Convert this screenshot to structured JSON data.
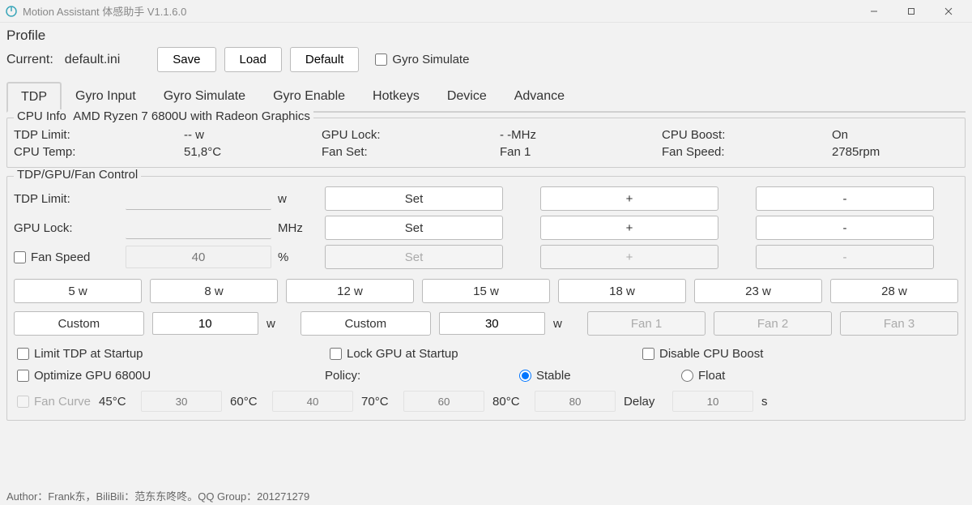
{
  "window": {
    "title": "Motion Assistant 体感助手 V1.1.6.0"
  },
  "profile": {
    "heading": "Profile",
    "current_label": "Current:",
    "current_value": "default.ini",
    "save": "Save",
    "load": "Load",
    "default": "Default",
    "gyro_simulate": "Gyro Simulate"
  },
  "tabs": [
    "TDP",
    "Gyro Input",
    "Gyro Simulate",
    "Gyro Enable",
    "Hotkeys",
    "Device",
    "Advance"
  ],
  "cpu_info": {
    "group": "CPU Info",
    "model": "AMD Ryzen 7 6800U with Radeon Graphics",
    "tdp_limit_lbl": "TDP Limit:",
    "tdp_limit_val": "-- w",
    "gpu_lock_lbl": "GPU Lock:",
    "gpu_lock_val": "- -MHz",
    "cpu_boost_lbl": "CPU Boost:",
    "cpu_boost_val": "On",
    "cpu_temp_lbl": "CPU Temp:",
    "cpu_temp_val": "51,8°C",
    "fan_set_lbl": "Fan Set:",
    "fan_set_val": "Fan 1",
    "fan_speed_lbl": "Fan Speed:",
    "fan_speed_val": "2785rpm"
  },
  "control": {
    "group": "TDP/GPU/Fan Control",
    "tdp_limit_lbl": "TDP Limit:",
    "tdp_limit_val": "",
    "tdp_unit": "w",
    "gpu_lock_lbl": "GPU Lock:",
    "gpu_lock_val": "",
    "gpu_unit": "MHz",
    "fan_speed_lbl": "Fan Speed",
    "fan_speed_val": "40",
    "fan_unit": "%",
    "set": "Set",
    "plus": "+",
    "minus": "-",
    "presets": [
      "5 w",
      "8 w",
      "12 w",
      "15 w",
      "18 w",
      "23 w",
      "28 w"
    ],
    "custom1_lbl": "Custom",
    "custom1_val": "10",
    "custom1_unit": "w",
    "custom2_lbl": "Custom",
    "custom2_val": "30",
    "custom2_unit": "w",
    "fan_buttons": [
      "Fan 1",
      "Fan 2",
      "Fan 3"
    ],
    "limit_tdp_startup": "Limit TDP at Startup",
    "lock_gpu_startup": "Lock GPU at Startup",
    "disable_cpu_boost": "Disable CPU Boost",
    "optimize_gpu": "Optimize GPU 6800U",
    "policy_lbl": "Policy:",
    "stable": "Stable",
    "float": "Float",
    "fan_curve_lbl": "Fan Curve",
    "fc_t1": "45°C",
    "fc_v1": "30",
    "fc_t2": "60°C",
    "fc_v2": "40",
    "fc_t3": "70°C",
    "fc_v3": "60",
    "fc_t4": "80°C",
    "fc_v4": "80",
    "delay_lbl": "Delay",
    "delay_val": "10",
    "delay_unit": "s"
  },
  "footer": "Author：Frank东，BiliBili：范东东咚咚。QQ Group：201271279"
}
